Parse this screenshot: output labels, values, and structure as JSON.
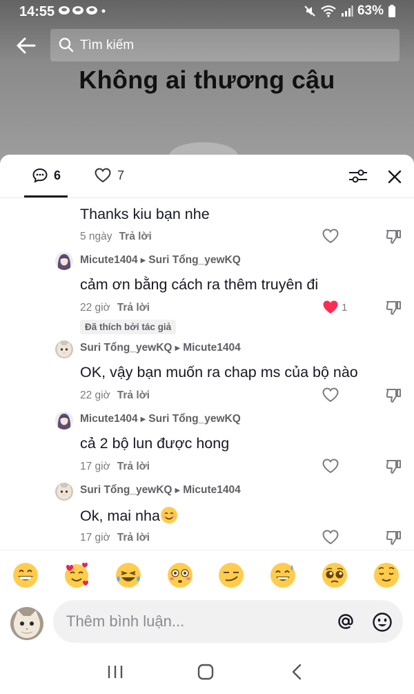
{
  "status_bar": {
    "time": "14:55",
    "notification_icons": "⚫⚫⚫ •",
    "battery": "63%"
  },
  "search": {
    "placeholder": "Tìm kiếm"
  },
  "video": {
    "title": "Không ai thương cậu"
  },
  "tabs": {
    "comments_count": "6",
    "likes_count": "7"
  },
  "comments": [
    {
      "text": "Thanks kiu bạn nhe",
      "time": "5 ngày",
      "reply_label": "Trả lời"
    },
    {
      "author": "Micute1404",
      "reply_to": "Suri Tổng_yewKQ",
      "avatar": "anime-girl",
      "text": "cảm ơn bằng cách ra thêm truyên đi",
      "time": "22 giờ",
      "reply_label": "Trả lời",
      "likes": "1",
      "liked": true,
      "badge": "Đã thích bởi tác giả"
    },
    {
      "author": "Suri Tổng_yewKQ",
      "reply_to": "Micute1404",
      "avatar": "cat",
      "text": "OK, vậy bạn muốn ra chap ms của bộ nào",
      "time": "22 giờ",
      "reply_label": "Trả lời"
    },
    {
      "author": "Micute1404",
      "reply_to": "Suri Tổng_yewKQ",
      "avatar": "anime-girl",
      "text": "cả 2 bộ lun được hong",
      "time": "17 giờ",
      "reply_label": "Trả lời"
    },
    {
      "author": "Suri Tổng_yewKQ",
      "reply_to": "Micute1404",
      "avatar": "cat",
      "text": "Ok, mai nha",
      "time": "17 giờ",
      "reply_label": "Trả lời"
    }
  ],
  "emoji_bar": [
    "grin",
    "smiling-face-with-hearts",
    "tears-of-joy",
    "flushed",
    "smirk",
    "sweat-smile",
    "pleading",
    "relieved"
  ],
  "comment_input": {
    "placeholder": "Thêm bình luận..."
  },
  "colors": {
    "accent_red": "#fe2c55",
    "panel_bg": "#ffffff",
    "text_primary": "#161823",
    "text_secondary": "#7a7b80"
  }
}
